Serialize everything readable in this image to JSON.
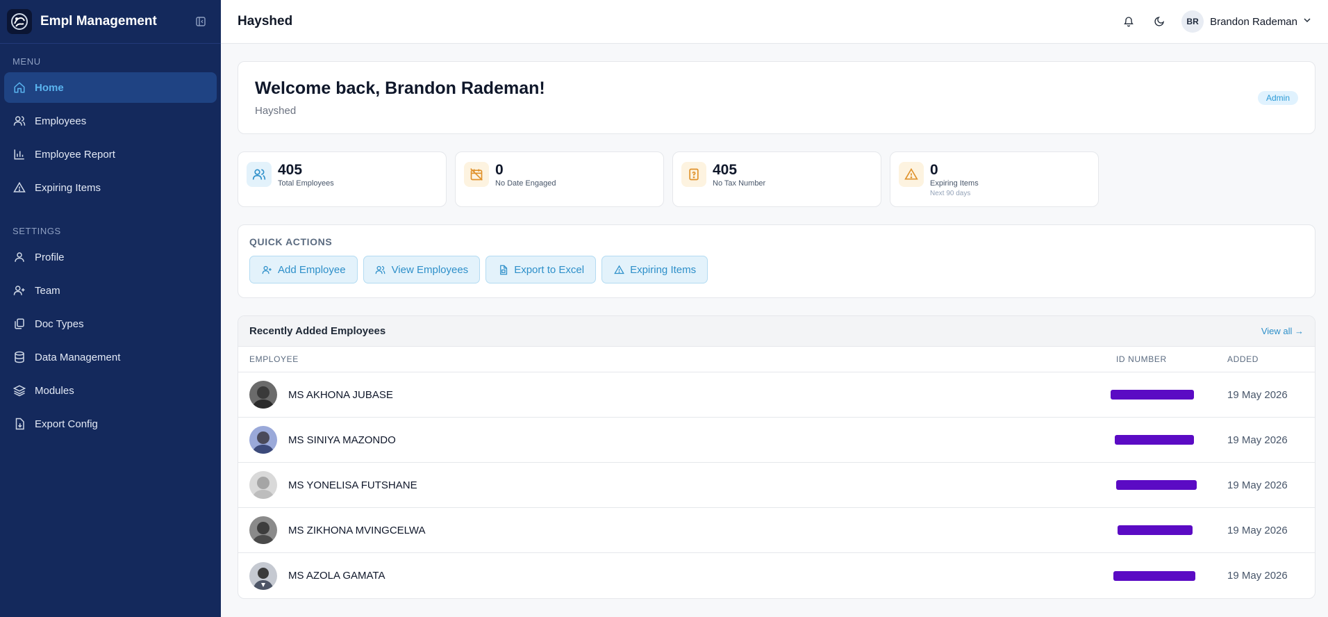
{
  "sidebar": {
    "title": "Empl Management",
    "menu_label": "MENU",
    "settings_label": "SETTINGS",
    "menu_items": [
      {
        "label": "Home",
        "icon": "home-icon"
      },
      {
        "label": "Employees",
        "icon": "users-icon"
      },
      {
        "label": "Employee Report",
        "icon": "bar-chart-icon"
      },
      {
        "label": "Expiring Items",
        "icon": "warning-icon"
      }
    ],
    "settings_items": [
      {
        "label": "Profile",
        "icon": "user-icon"
      },
      {
        "label": "Team",
        "icon": "user-plus-icon"
      },
      {
        "label": "Doc Types",
        "icon": "files-icon"
      },
      {
        "label": "Data Management",
        "icon": "database-icon"
      },
      {
        "label": "Modules",
        "icon": "layers-icon"
      },
      {
        "label": "Export Config",
        "icon": "file-download-icon"
      }
    ]
  },
  "header": {
    "title": "Hayshed",
    "user_initials": "BR",
    "user_name": "Brandon Rademan"
  },
  "welcome": {
    "heading": "Welcome back, Brandon Rademan!",
    "org": "Hayshed",
    "role": "Admin"
  },
  "stats": [
    {
      "value": "405",
      "label": "Total Employees",
      "note": ""
    },
    {
      "value": "0",
      "label": "No Date Engaged",
      "note": ""
    },
    {
      "value": "405",
      "label": "No Tax Number",
      "note": ""
    },
    {
      "value": "0",
      "label": "Expiring Items",
      "note": "Next 90 days"
    }
  ],
  "quick_actions": {
    "title": "QUICK ACTIONS",
    "buttons": [
      "Add Employee",
      "View Employees",
      "Export to Excel",
      "Expiring Items"
    ]
  },
  "recent": {
    "title": "Recently Added Employees",
    "view_all": "View all →",
    "columns": [
      "EMPLOYEE",
      "ID NUMBER",
      "ADDED"
    ],
    "rows": [
      {
        "name": "MS AKHONA JUBASE",
        "added": "19 May 2026"
      },
      {
        "name": "MS SINIYA MAZONDO",
        "added": "19 May 2026"
      },
      {
        "name": "MS YONELISA FUTSHANE",
        "added": "19 May 2026"
      },
      {
        "name": "MS ZIKHONA MVINGCELWA",
        "added": "19 May 2026"
      },
      {
        "name": "MS AZOLA GAMATA",
        "added": "19 May 2026"
      }
    ]
  },
  "colors": {
    "sidebar_bg": "#14295c",
    "accent": "#2d8fc9",
    "redaction": "#5b0bc4"
  }
}
